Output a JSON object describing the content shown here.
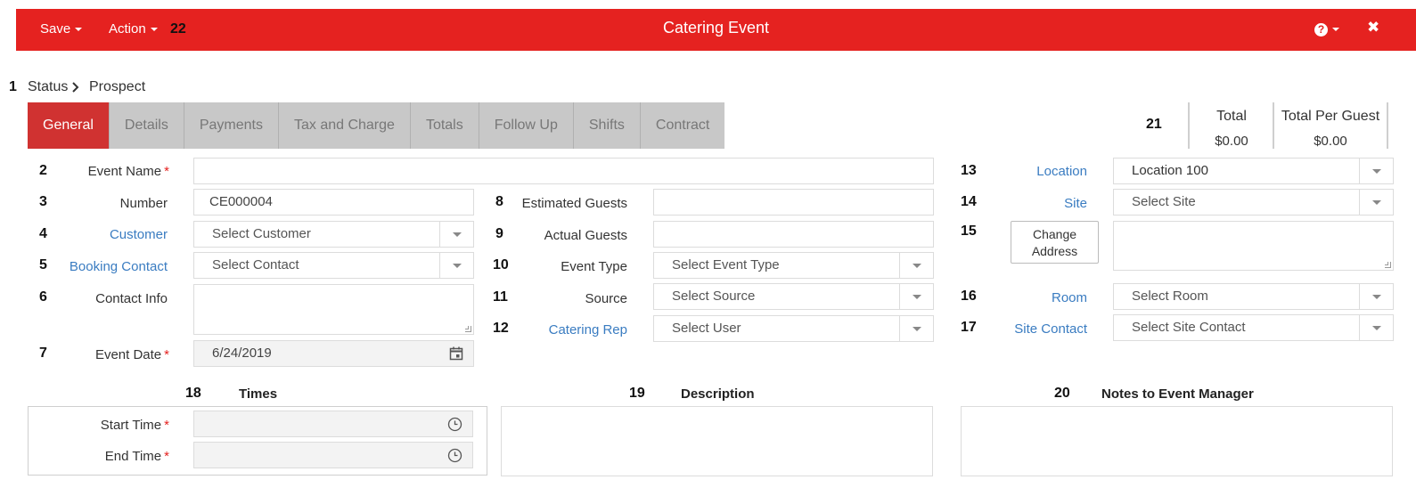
{
  "header": {
    "save_label": "Save",
    "action_label": "Action",
    "action_num": "22",
    "title": "Catering Event",
    "help_icon": "?",
    "close_icon": "✖"
  },
  "status": {
    "num": "1",
    "label": "Status",
    "value": "Prospect"
  },
  "tabs": [
    {
      "label": "General"
    },
    {
      "label": "Details"
    },
    {
      "label": "Payments"
    },
    {
      "label": "Tax and Charge"
    },
    {
      "label": "Totals"
    },
    {
      "label": "Follow Up"
    },
    {
      "label": "Shifts"
    },
    {
      "label": "Contract"
    }
  ],
  "totals": {
    "num": "21",
    "total_label": "Total",
    "total_value": "$0.00",
    "per_guest_label": "Total Per Guest",
    "per_guest_value": "$0.00"
  },
  "left": {
    "event_name": {
      "num": "2",
      "label": "Event Name",
      "value": ""
    },
    "number": {
      "num": "3",
      "label": "Number",
      "value": "CE000004"
    },
    "customer": {
      "num": "4",
      "label": "Customer",
      "placeholder": "Select Customer"
    },
    "booking_contact": {
      "num": "5",
      "label": "Booking Contact",
      "placeholder": "Select Contact"
    },
    "contact_info": {
      "num": "6",
      "label": "Contact Info"
    },
    "event_date": {
      "num": "7",
      "label": "Event Date",
      "value": "6/24/2019"
    }
  },
  "middle": {
    "estimated_guests": {
      "num": "8",
      "label": "Estimated Guests",
      "value": ""
    },
    "actual_guests": {
      "num": "9",
      "label": "Actual Guests",
      "value": ""
    },
    "event_type": {
      "num": "10",
      "label": "Event Type",
      "placeholder": "Select Event Type"
    },
    "source": {
      "num": "11",
      "label": "Source",
      "placeholder": "Select Source"
    },
    "catering_rep": {
      "num": "12",
      "label": "Catering Rep",
      "placeholder": "Select User"
    }
  },
  "right": {
    "location": {
      "num": "13",
      "label": "Location",
      "value": "Location 100"
    },
    "site": {
      "num": "14",
      "label": "Site",
      "placeholder": "Select Site"
    },
    "address": {
      "num": "15",
      "button_label": "Change Address"
    },
    "room": {
      "num": "16",
      "label": "Room",
      "placeholder": "Select Room"
    },
    "site_contact": {
      "num": "17",
      "label": "Site Contact",
      "placeholder": "Select Site Contact"
    }
  },
  "times": {
    "num": "18",
    "title": "Times",
    "start_label": "Start Time",
    "end_label": "End Time"
  },
  "description": {
    "num": "19",
    "title": "Description"
  },
  "notes": {
    "num": "20",
    "title": "Notes to Event Manager"
  },
  "required_mark": "*",
  "colors": {
    "brand_red": "#e52220",
    "tab_active": "#d03231",
    "link_blue": "#3a7cc1"
  }
}
